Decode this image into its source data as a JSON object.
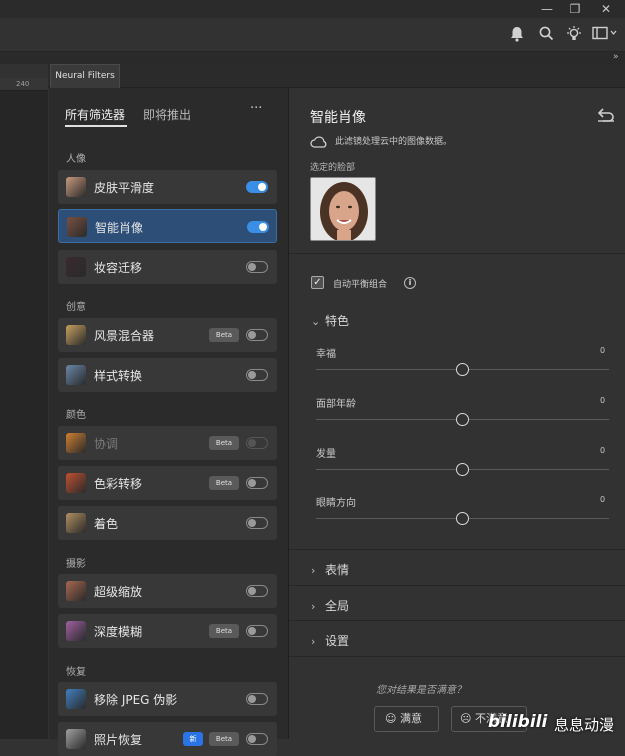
{
  "window": {
    "minimize": "—",
    "restore": "❐",
    "close": "✕"
  },
  "appbar_icons": [
    "bell-icon",
    "search-icon",
    "lightbulb-icon",
    "panel-layout-icon"
  ],
  "expand_arrow": "»",
  "ruler_label": "240",
  "panel_tab": "Neural Filters",
  "left": {
    "tabs": [
      {
        "label": "所有筛选器",
        "active": true
      },
      {
        "label": "即将推出",
        "active": false
      }
    ],
    "more": "···",
    "categories": [
      {
        "label": "人像",
        "items": [
          {
            "label": "皮肤平滑度",
            "on": true,
            "selected": false,
            "badges": [],
            "dim": false
          },
          {
            "label": "智能肖像",
            "on": true,
            "selected": true,
            "badges": [],
            "dim": false
          },
          {
            "label": "妆容迁移",
            "on": false,
            "selected": false,
            "badges": [],
            "dim": false
          }
        ]
      },
      {
        "label": "创意",
        "items": [
          {
            "label": "风景混合器",
            "on": false,
            "selected": false,
            "badges": [
              "Beta"
            ],
            "dim": false
          },
          {
            "label": "样式转换",
            "on": false,
            "selected": false,
            "badges": [],
            "dim": false
          }
        ]
      },
      {
        "label": "颜色",
        "items": [
          {
            "label": "协调",
            "on": false,
            "selected": false,
            "badges": [
              "Beta"
            ],
            "dim": true
          },
          {
            "label": "色彩转移",
            "on": false,
            "selected": false,
            "badges": [
              "Beta"
            ],
            "dim": false
          },
          {
            "label": "着色",
            "on": false,
            "selected": false,
            "badges": [],
            "dim": false
          }
        ]
      },
      {
        "label": "摄影",
        "items": [
          {
            "label": "超级缩放",
            "on": false,
            "selected": false,
            "badges": [],
            "dim": false
          },
          {
            "label": "深度模糊",
            "on": false,
            "selected": false,
            "badges": [
              "Beta"
            ],
            "dim": false
          }
        ]
      },
      {
        "label": "恢复",
        "items": [
          {
            "label": "移除 JPEG 伪影",
            "on": false,
            "selected": false,
            "badges": [],
            "dim": false
          },
          {
            "label": "照片恢复",
            "on": false,
            "selected": false,
            "badges": [
              "新",
              "Beta"
            ],
            "dim": false
          }
        ]
      }
    ]
  },
  "right": {
    "title": "智能肖像",
    "reset_icon": "undo-icon",
    "cloud_note": "此滤镜处理云中的图像数据。",
    "selected_face_label": "选定的脸部",
    "auto_balance": {
      "label": "自动平衡组合",
      "checked": true
    },
    "features_section": "特色",
    "sliders": [
      {
        "label": "幸福",
        "value": "0",
        "position": 0.5
      },
      {
        "label": "面部年龄",
        "value": "0",
        "position": 0.5
      },
      {
        "label": "发量",
        "value": "0",
        "position": 0.5
      },
      {
        "label": "眼睛方向",
        "value": "0",
        "position": 0.5
      }
    ],
    "collapsed_sections": [
      "表情",
      "全局",
      "设置"
    ],
    "feedback": {
      "question": "您对结果是否满意？",
      "satisfied": "满意",
      "unsatisfied": "不满意"
    }
  },
  "watermark": {
    "logo": "bilibili",
    "text": "息息动漫"
  }
}
